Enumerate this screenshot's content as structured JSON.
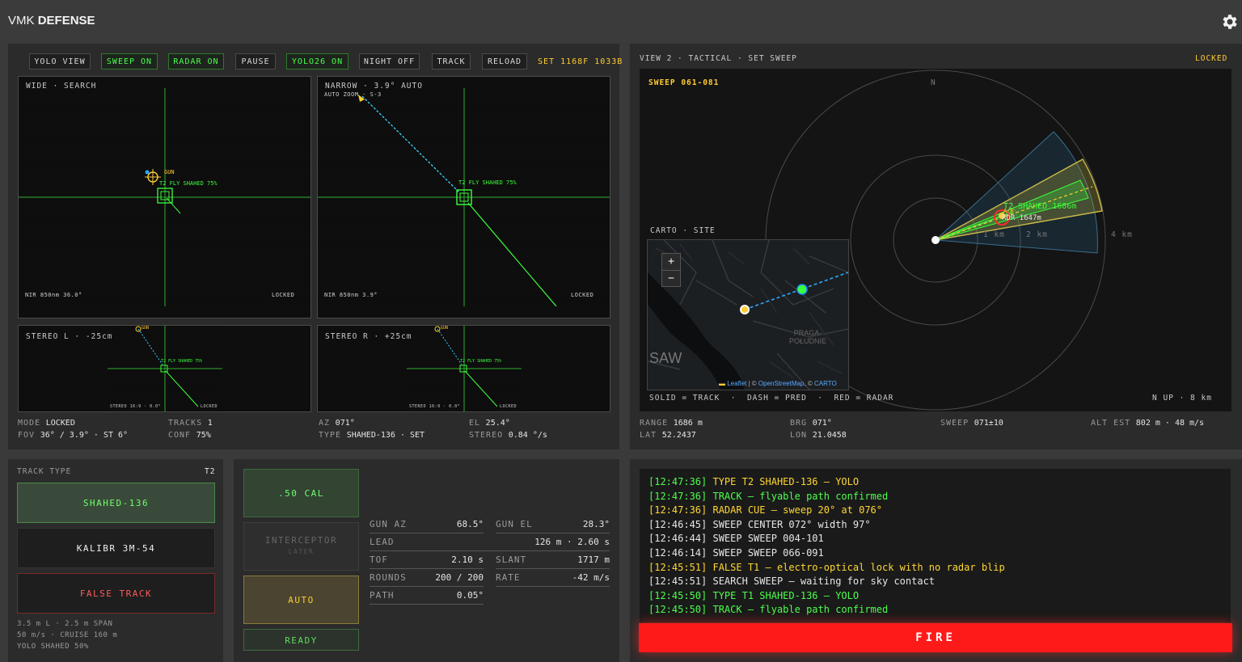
{
  "app": {
    "brand_pre": "VMK",
    "brand_post": "DEFENSE",
    "settings_icon": "gear-icon"
  },
  "toolbar": {
    "buttons": [
      {
        "label": "YOLO VIEW",
        "on": false
      },
      {
        "label": "SWEEP ON",
        "on": true
      },
      {
        "label": "RADAR ON",
        "on": true
      },
      {
        "label": "PAUSE",
        "on": false
      },
      {
        "label": "YOLO26 ON",
        "on": true
      },
      {
        "label": "NIGHT OFF",
        "on": false
      },
      {
        "label": "TRACK",
        "on": false
      },
      {
        "label": "RELOAD",
        "on": false
      }
    ],
    "set_info": "SET 1168F 1033B"
  },
  "wide": {
    "title": "WIDE · SEARCH",
    "gun_label": "GUN",
    "target_label": "T2 FLY SHAHED  75%",
    "footer_left": "NIR 850nm  36.0°",
    "footer_right": "LOCKED"
  },
  "narrow": {
    "title": "NARROW · 3.9° AUTO",
    "sub": "AUTO ZOOM · S-3",
    "target_label": "T2 FLY SHAHED  75%",
    "footer_left": "NIR 850nm  3.9°",
    "footer_right": "LOCKED"
  },
  "stereo_l": {
    "title": "STEREO L · -25cm",
    "gun": "GUN",
    "target": "T2 FLY SHAHED 75%",
    "foot_l": "STEREO 16:9 · 0.0°",
    "foot_r": "LOCKED"
  },
  "stereo_r": {
    "title": "STEREO R · +25cm",
    "gun": "GUN",
    "target": "T2 FLY SHAHED 75%",
    "foot_l": "STEREO 16:9 · 0.0°",
    "foot_r": "LOCKED"
  },
  "stats_left": {
    "mode_k": "MODE",
    "mode_v": "LOCKED",
    "fov_k": "FOV",
    "fov_v": "36° / 3.9° · ST 6°",
    "tracks_k": "TRACKS",
    "tracks_v": "1",
    "conf_k": "CONF",
    "conf_v": "75%",
    "az_k": "AZ",
    "az_v": "071°",
    "type_k": "TYPE",
    "type_v": "SHAHED-136 · SET",
    "el_k": "EL",
    "el_v": "25.4°",
    "stereo_k": "STEREO",
    "stereo_v": "0.84 °/s"
  },
  "tactical": {
    "title": "VIEW 2 · TACTICAL · SET SWEEP",
    "status": "LOCKED",
    "sweep_label": "SWEEP 061-081",
    "north": "N",
    "ring_1km": "1 km",
    "ring_2km": "2 km",
    "ring_4km": "4 km",
    "target_name": "T2 SHAHED  1686m",
    "target_ab": "A/B",
    "radar_label": "RDR 1647m",
    "map_title": "CARTO · SITE",
    "zoom_in": "+",
    "zoom_out": "−",
    "map_district": "PRAGA-\nPOŁUDNIE",
    "map_saw": "SAW",
    "attribution_leaflet": "Leaflet",
    "attribution_osm": "OpenStreetMap",
    "attribution_carto": "CARTO",
    "legend": "SOLID = TRACK  ·  DASH = PRED  ·  RED = RADAR",
    "scale": "N UP · 8 km",
    "range_k": "RANGE",
    "range_v": "1686 m",
    "brg_k": "BRG",
    "brg_v": "071°",
    "sweep_k": "SWEEP",
    "sweep_v": "071±10",
    "alt_k": "ALT EST",
    "alt_v": "802 m · 48 m/s",
    "lat_k": "LAT",
    "lat_v": "52.2437",
    "lon_k": "LON",
    "lon_v": "21.0458"
  },
  "track_type": {
    "header": "TRACK TYPE",
    "id": "T2",
    "options": [
      "SHAHED-136",
      "KALIBR 3M-54",
      "FALSE TRACK"
    ],
    "spec1": "3.5 m L · 2.5 m SPAN",
    "spec2": "50 m/s · CRUISE 160 m",
    "spec3": "YOLO SHAHED 50%"
  },
  "weapons": {
    "cal": ".50 CAL",
    "interceptor": "INTERCEPTOR",
    "interceptor_sub": "LATER",
    "auto": "AUTO",
    "ready": "READY"
  },
  "ballistics": [
    {
      "k": "GUN AZ",
      "v": "68.5°"
    },
    {
      "k": "GUN EL",
      "v": "28.3°"
    },
    {
      "k": "LEAD",
      "v": "126 m · 2.60 s"
    },
    {
      "k": "TOF",
      "v": "2.10 s"
    },
    {
      "k": "SLANT",
      "v": "1717 m"
    },
    {
      "k": "ROUNDS",
      "v": "200 / 200"
    },
    {
      "k": "RATE",
      "v": "-42 m/s"
    },
    {
      "k": "PATH",
      "v": "0.05°"
    }
  ],
  "log": [
    {
      "time": "[12:47:36]",
      "msg": "TYPE T2 SHAHED-136 — YOLO",
      "color": "#ffd633",
      "tcolor": "#4cff4c"
    },
    {
      "time": "[12:47:36]",
      "msg": "TRACK — flyable path confirmed",
      "color": "#4cff4c",
      "tcolor": "#4cff4c"
    },
    {
      "time": "[12:47:36]",
      "msg": "RADAR CUE — sweep 20° at 076°",
      "color": "#ffd633",
      "tcolor": "#ffd633"
    },
    {
      "time": "[12:46:45]",
      "msg": "SWEEP CENTER 072° width 97°",
      "color": "#e6e6e6",
      "tcolor": "#e6e6e6"
    },
    {
      "time": "[12:46:44]",
      "msg": "SWEEP SWEEP 004-101",
      "color": "#e6e6e6",
      "tcolor": "#e6e6e6"
    },
    {
      "time": "[12:46:14]",
      "msg": "SWEEP SWEEP 066-091",
      "color": "#e6e6e6",
      "tcolor": "#e6e6e6"
    },
    {
      "time": "[12:45:51]",
      "msg": "FALSE T1 — electro-optical lock with no radar blip",
      "color": "#ffd633",
      "tcolor": "#ffd633"
    },
    {
      "time": "[12:45:51]",
      "msg": "SEARCH SWEEP — waiting for sky contact",
      "color": "#e6e6e6",
      "tcolor": "#e6e6e6"
    },
    {
      "time": "[12:45:50]",
      "msg": "TYPE T1 SHAHED-136 — YOLO",
      "color": "#4cff4c",
      "tcolor": "#4cff4c"
    },
    {
      "time": "[12:45:50]",
      "msg": "TRACK — flyable path confirmed",
      "color": "#4cff4c",
      "tcolor": "#4cff4c"
    }
  ],
  "fire_label": "FIRE",
  "colors": {
    "accent_green": "#4cff4c",
    "accent_yellow": "#ffcc33",
    "alert_red": "#ff1a1a"
  }
}
